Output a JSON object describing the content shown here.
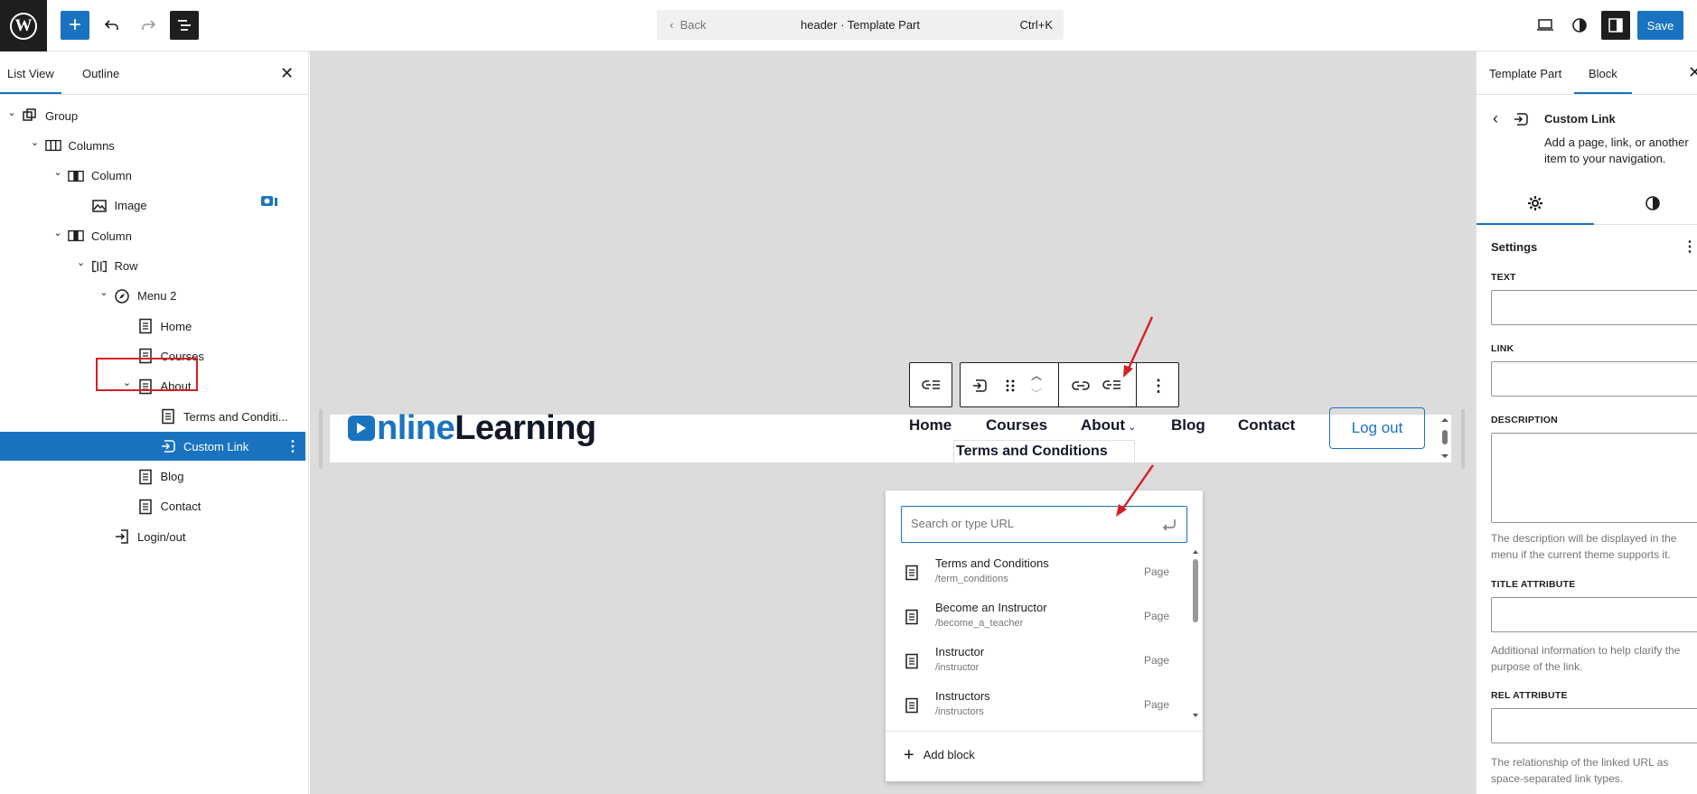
{
  "topbar": {
    "add_label": "+",
    "command": {
      "back": "Back",
      "title": "header · Template Part",
      "shortcut": "Ctrl+K"
    },
    "save_label": "Save"
  },
  "list_view": {
    "tabs": [
      "List View",
      "Outline"
    ],
    "items": [
      {
        "label": "Group",
        "icon": "group-icon",
        "depth": 0,
        "expanded": true
      },
      {
        "label": "Columns",
        "icon": "columns-icon",
        "depth": 1,
        "expanded": true
      },
      {
        "label": "Column",
        "icon": "column-icon",
        "depth": 2,
        "expanded": true
      },
      {
        "label": "Image",
        "icon": "image-icon",
        "depth": 3,
        "expanded": null
      },
      {
        "label": "Column",
        "icon": "column-icon",
        "depth": 2,
        "expanded": true
      },
      {
        "label": "Row",
        "icon": "row-icon",
        "depth": 3,
        "expanded": true
      },
      {
        "label": "Menu 2",
        "icon": "navigation-icon",
        "depth": 4,
        "expanded": true
      },
      {
        "label": "Home",
        "icon": "page-icon",
        "depth": 5,
        "expanded": null
      },
      {
        "label": "Courses",
        "icon": "page-icon",
        "depth": 5,
        "expanded": null
      },
      {
        "label": "About",
        "icon": "page-icon",
        "depth": 5,
        "expanded": true
      },
      {
        "label": "Terms and Conditi...",
        "icon": "page-icon",
        "depth": 6,
        "expanded": null
      },
      {
        "label": "Custom Link",
        "icon": "custom-link-icon",
        "depth": 6,
        "expanded": null,
        "selected": true
      },
      {
        "label": "Blog",
        "icon": "page-icon",
        "depth": 5,
        "expanded": null
      },
      {
        "label": "Contact",
        "icon": "page-icon",
        "depth": 5,
        "expanded": null
      },
      {
        "label": "Login/out",
        "icon": "login-icon",
        "depth": 4,
        "expanded": null
      }
    ]
  },
  "canvas": {
    "logo_part1": "nline",
    "logo_part2": "Learning",
    "nav": [
      "Home",
      "Courses",
      "About",
      "Blog",
      "Contact"
    ],
    "logout_label": "Log out",
    "submenu_item": "Terms and Conditions",
    "link_popover": {
      "placeholder": "Search or type URL",
      "results": [
        {
          "title": "Terms and Conditions",
          "url": "/term_conditions",
          "type": "Page"
        },
        {
          "title": "Become an Instructor",
          "url": "/become_a_teacher",
          "type": "Page"
        },
        {
          "title": "Instructor",
          "url": "/instructor",
          "type": "Page"
        },
        {
          "title": "Instructors",
          "url": "/instructors",
          "type": "Page"
        }
      ],
      "add_block_label": "Add block"
    }
  },
  "settings_panel": {
    "tabs": [
      "Template Part",
      "Block"
    ],
    "block_card": {
      "title": "Custom Link",
      "description": "Add a page, link, or another item to your navigation."
    },
    "section_title": "Settings",
    "fields": {
      "text_label": "TEXT",
      "link_label": "LINK",
      "description_label": "DESCRIPTION",
      "description_help": "The description will be displayed in the menu if the current theme supports it.",
      "title_attr_label": "TITLE ATTRIBUTE",
      "title_attr_help": "Additional information to help clarify the purpose of the link.",
      "rel_attr_label": "REL ATTRIBUTE",
      "rel_attr_help": "The relationship of the linked URL as space-separated link types."
    }
  },
  "colors": {
    "accent": "#1a73c0",
    "annotation": "#d62020",
    "canvas_bg": "#dcdcdc"
  }
}
